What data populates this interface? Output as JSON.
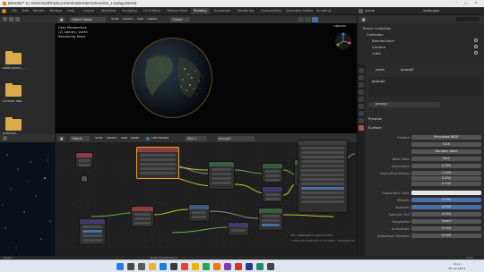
{
  "window": {
    "title": "Blender* [C:\\Users\\s4th\\Documents\\Blender\\Universe_1\\Sdag.blend]"
  },
  "menu": {
    "items": [
      "File",
      "Edit",
      "Render",
      "Window",
      "Help"
    ]
  },
  "workspace_tabs": [
    "Layout",
    "Modeling",
    "Sculpting",
    "UV Editing",
    "Texture Paint",
    "Shading",
    "Animation",
    "Rendering",
    "Compositing",
    "Geometry Nodes",
    "Scripting"
  ],
  "active_tab": "Shading",
  "left_panel": {
    "folders": [
      "AfterColors_...",
      "Archive Rob",
      "Bitmaps..."
    ]
  },
  "viewport": {
    "mode": "Object Mode",
    "menu": [
      "View",
      "Select",
      "Add",
      "Object"
    ],
    "orientation": "Global",
    "options_label": "Options",
    "info_lines": [
      "User Perspective",
      "(2) stones | earth",
      "Rendering Done"
    ]
  },
  "node_editor": {
    "mode": "Object",
    "menu": [
      "View",
      "Select",
      "Add",
      "Node"
    ],
    "use_nodes_label": "Use Nodes",
    "slot": "Slot 1",
    "material": "phong3"
  },
  "outliner": {
    "title": "Scene Collection",
    "view_layer": "ViewLayer",
    "scene": "Scene",
    "items": [
      "Collection",
      "BlenderLayer",
      "Camera",
      "Cube"
    ]
  },
  "properties": {
    "object_name": "earth",
    "material_name": "phong3",
    "material_slot": "phong3",
    "section_preview": "Preview",
    "section_surface": "Surface",
    "rows": [
      {
        "label": "Surface",
        "value": "Principled BSDF"
      },
      {
        "label": "",
        "value": "GGX"
      },
      {
        "label": "",
        "value": "Random Walk"
      },
      {
        "label": "Base Color",
        "value": "Tex1"
      },
      {
        "label": "Subsurface",
        "value": "0.000"
      },
      {
        "label": "Subsurface Radius",
        "value": "1.000"
      },
      {
        "label": "",
        "value": "0.200"
      },
      {
        "label": "",
        "value": "0.100"
      },
      {
        "label": "Subsurface Color",
        "value": ""
      },
      {
        "label": "Metallic",
        "value": "0.000"
      },
      {
        "label": "Specular",
        "value": "0.500"
      },
      {
        "label": "Specular Tint",
        "value": "0.000"
      },
      {
        "label": "Roughness",
        "value": "Invert"
      },
      {
        "label": "Anisotropic",
        "value": "0.000"
      },
      {
        "label": "Anisotropic Rotation",
        "value": "0.000"
      }
    ]
  },
  "activation": {
    "line1": "Активация Windows",
    "line2": "Чтобы активировать Windows, перейдите в раздел «Параметры»."
  },
  "statusbar": {
    "left": "Select",
    "center": "Node Context Menu",
    "right": "2.5.0"
  },
  "taskbar": {
    "time": "4:11",
    "date": "30.12.2021"
  }
}
